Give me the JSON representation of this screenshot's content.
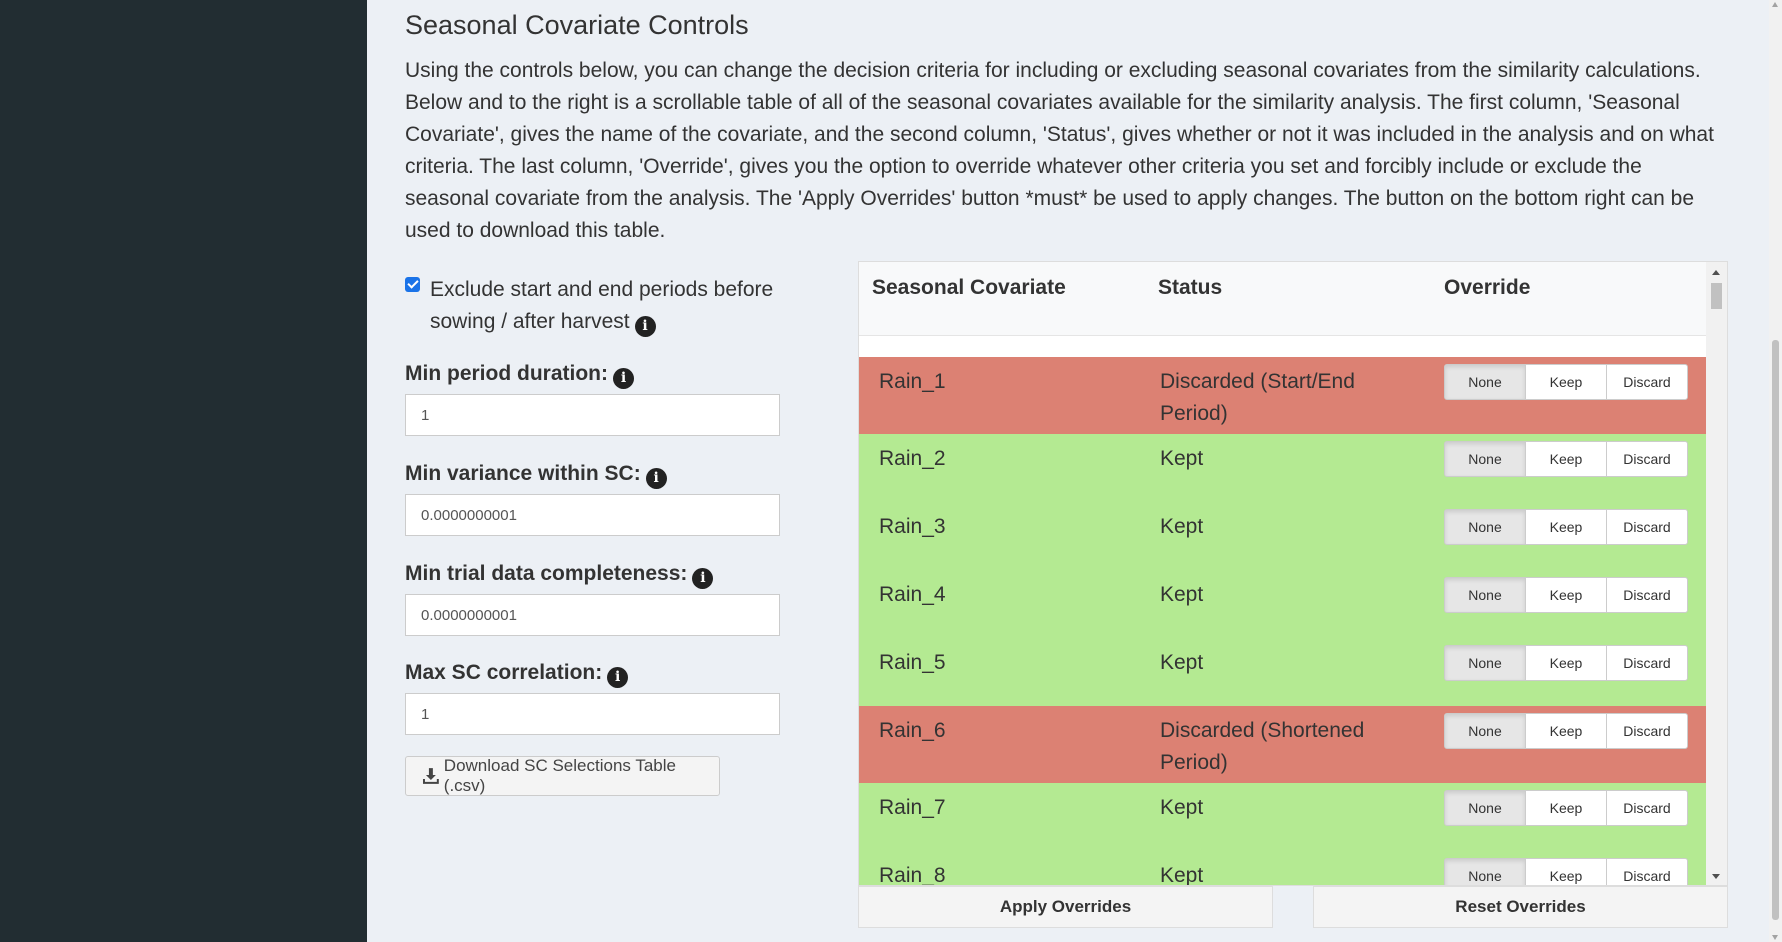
{
  "title": "Seasonal Covariate Controls",
  "description": "Using the controls below, you can change the decision criteria for including or excluding seasonal covariates from the similarity calculations. Below and to the right is a scrollable table of all of the seasonal covariates available for the similarity analysis. The first column, 'Seasonal Covariate', gives the name of the covariate, and the second column, 'Status', gives whether or not it was included in the analysis and on what criteria. The last column, 'Override', gives you the option to override whatever other criteria you set and forcibly include or exclude the seasonal covariate from the analysis. The 'Apply Overrides' button *must* be used to apply changes. The button on the bottom right can be used to download this table.",
  "exclude_checkbox": {
    "label": "Exclude start and end periods before sowing / after harvest",
    "checked": true
  },
  "fields": {
    "min_period": {
      "label": "Min period duration:",
      "value": "1"
    },
    "min_variance": {
      "label": "Min variance within SC:",
      "value": "0.0000000001"
    },
    "min_completeness": {
      "label": "Min trial data completeness:",
      "value": "0.0000000001"
    },
    "max_correlation": {
      "label": "Max SC correlation:",
      "value": "1"
    }
  },
  "download_button": "Download SC Selections Table (.csv)",
  "info_glyph": "i",
  "table": {
    "headers": {
      "covariate": "Seasonal Covariate",
      "status": "Status",
      "override": "Override"
    },
    "override_options": {
      "none": "None",
      "keep": "Keep",
      "discard": "Discard"
    },
    "rows": [
      {
        "name": "Rain_1",
        "status": "Discarded (Start/End Period)",
        "state": "discarded",
        "override": "None"
      },
      {
        "name": "Rain_2",
        "status": "Kept",
        "state": "kept",
        "override": "None"
      },
      {
        "name": "Rain_3",
        "status": "Kept",
        "state": "kept",
        "override": "None"
      },
      {
        "name": "Rain_4",
        "status": "Kept",
        "state": "kept",
        "override": "None"
      },
      {
        "name": "Rain_5",
        "status": "Kept",
        "state": "kept",
        "override": "None"
      },
      {
        "name": "Rain_6",
        "status": "Discarded (Shortened Period)",
        "state": "discarded",
        "override": "None"
      },
      {
        "name": "Rain_7",
        "status": "Kept",
        "state": "kept",
        "override": "None"
      },
      {
        "name": "Rain_8",
        "status": "Kept",
        "state": "kept",
        "override": "None"
      }
    ]
  },
  "apply_button": "Apply Overrides",
  "reset_button": "Reset Overrides",
  "colors": {
    "sidebar": "#222d32",
    "discarded_row": "#dc8173",
    "kept_row": "#b4ea92",
    "background": "#ecf0f5"
  }
}
